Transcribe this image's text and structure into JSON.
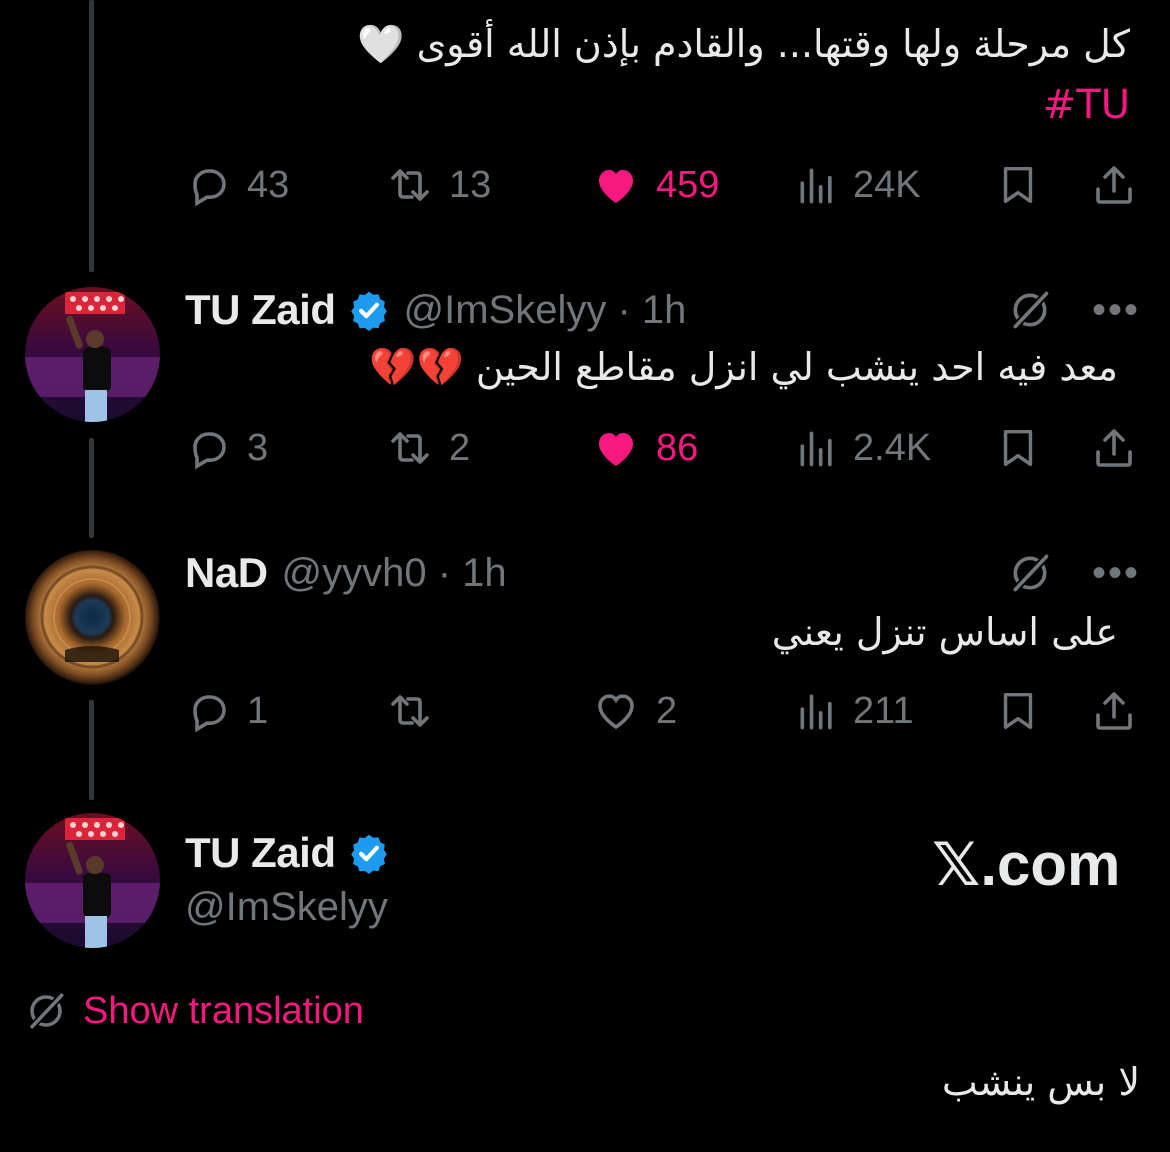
{
  "colors": {
    "background": "#000000",
    "text": "#e7e9ea",
    "muted": "#71767b",
    "accent_pink": "#f91880",
    "verified_blue": "#1d9bf0"
  },
  "tweets": [
    {
      "text": "كل مرحلة ولها وقتها... والقادم بإذن الله أقوى 🤍",
      "hashtag": "#TU",
      "actions": {
        "replies": "43",
        "reposts": "13",
        "likes": "459",
        "liked": true,
        "views": "24K"
      }
    },
    {
      "name": "TU Zaid",
      "verified": true,
      "handle_time": "@ImSkelyy · 1h",
      "text": "معد فيه احد ينشب لي انزل مقاطع الحين 💔💔",
      "actions": {
        "replies": "3",
        "reposts": "2",
        "likes": "86",
        "liked": true,
        "views": "2.4K"
      }
    },
    {
      "name": "NaD",
      "verified": false,
      "handle_time": "@yyvh0 · 1h",
      "text": "على اساس تنزل يعني",
      "actions": {
        "replies": "1",
        "reposts": "",
        "likes": "2",
        "liked": false,
        "views": "211"
      }
    },
    {
      "name": "TU Zaid",
      "verified": true,
      "handle": "@ImSkelyy",
      "watermark": "𝕏.com",
      "show_translation": "Show translation",
      "text": "لا بس ينشب"
    }
  ],
  "icons": [
    "reply-icon",
    "repost-icon",
    "like-icon",
    "views-icon",
    "bookmark-icon",
    "share-icon",
    "grok-icon",
    "more-icon",
    "verified-icon",
    "translate-icon"
  ]
}
